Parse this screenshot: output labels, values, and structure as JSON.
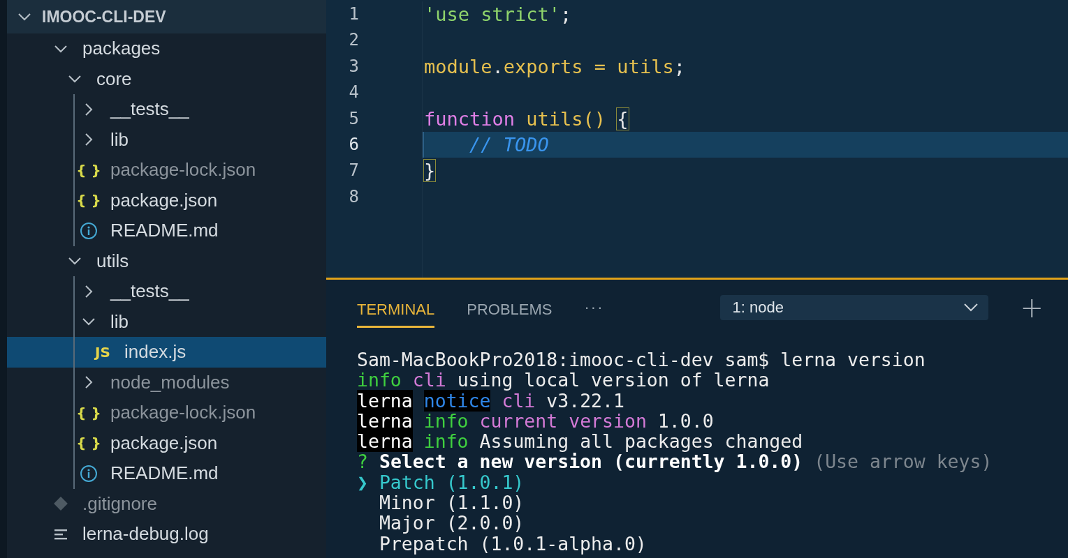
{
  "explorer": {
    "root": {
      "label": "IMOOC-CLI-DEV",
      "expanded": true
    },
    "items": [
      {
        "label": "packages",
        "kind": "folder",
        "expanded": true,
        "children": [
          {
            "label": "core",
            "kind": "folder",
            "expanded": true,
            "children": [
              {
                "label": "__tests__",
                "kind": "folder",
                "expanded": false
              },
              {
                "label": "lib",
                "kind": "folder",
                "expanded": false
              },
              {
                "icon": "{ }",
                "label": "package-lock.json",
                "kind": "json",
                "ignored": true
              },
              {
                "icon": "{ }",
                "label": "package.json",
                "kind": "json",
                "ignored": false
              },
              {
                "label": "README.md",
                "kind": "info",
                "ignored": false
              }
            ]
          },
          {
            "label": "utils",
            "kind": "folder",
            "expanded": true,
            "children": [
              {
                "label": "__tests__",
                "kind": "folder",
                "expanded": false
              },
              {
                "label": "lib",
                "kind": "folder",
                "expanded": true,
                "children": [
                  {
                    "icon": "JS",
                    "label": "index.js",
                    "kind": "js",
                    "ignored": false,
                    "selected": true
                  }
                ]
              },
              {
                "label": "node_modules",
                "kind": "folder",
                "expanded": false,
                "ignored": true
              },
              {
                "icon": "{ }",
                "label": "package-lock.json",
                "kind": "json",
                "ignored": true
              },
              {
                "icon": "{ }",
                "label": "package.json",
                "kind": "json",
                "ignored": false
              },
              {
                "label": "README.md",
                "kind": "info",
                "ignored": false
              }
            ]
          }
        ]
      },
      {
        "label": ".gitignore",
        "kind": "git",
        "ignored": true
      },
      {
        "label": "lerna-debug.log",
        "kind": "log",
        "ignored": false
      }
    ]
  },
  "editor": {
    "lines": [
      {
        "number": "1",
        "current": false,
        "tokens": [
          {
            "text": "'use strict'",
            "kind": "string"
          },
          {
            "text": ";",
            "kind": "punct"
          }
        ]
      },
      {
        "number": "2",
        "current": false
      },
      {
        "number": "3",
        "current": false,
        "tokens": [
          {
            "text": "module",
            "kind": "identifier"
          },
          {
            "text": ".",
            "kind": "punct"
          },
          {
            "text": "exports = utils",
            "kind": "identifier"
          },
          {
            "text": ";",
            "kind": "punct"
          }
        ]
      },
      {
        "number": "4",
        "current": false
      },
      {
        "number": "5",
        "current": false,
        "tokens": [
          {
            "text": "function",
            "kind": "keyword"
          },
          {
            "text": " utils() ",
            "kind": "identifier"
          },
          {
            "text": "{",
            "kind": "bracket"
          }
        ]
      },
      {
        "number": "6",
        "current": true,
        "tokens": [
          {
            "text": "    // TODO",
            "kind": "comment"
          }
        ]
      },
      {
        "number": "7",
        "current": false,
        "tokens": [
          {
            "text": "}",
            "kind": "bracket"
          }
        ]
      },
      {
        "number": "8",
        "current": false
      }
    ]
  },
  "panel": {
    "tabs": [
      {
        "label": "TERMINAL",
        "selected": true
      },
      {
        "label": "PROBLEMS",
        "selected": false
      }
    ],
    "more": "···",
    "terminal_select": "1: node",
    "add": "+",
    "terminal": [
      [
        {
          "text": "Sam-MacBookPro2018:imooc-cli-dev sam$ lerna version",
          "kind": "output"
        }
      ],
      [
        {
          "text": "info",
          "kind": "level"
        },
        {
          "text": " cli",
          "kind": "scope"
        },
        {
          "text": " using local version of lerna",
          "kind": "output"
        }
      ],
      [
        {
          "text": "lerna",
          "kind": "prefix"
        },
        {
          "text": " notice",
          "kind": "notice"
        },
        {
          "text": " cli",
          "kind": "scope"
        },
        {
          "text": " v3.22.1",
          "kind": "output"
        }
      ],
      [
        {
          "text": "lerna",
          "kind": "prefix"
        },
        {
          "text": " info",
          "kind": "level"
        },
        {
          "text": " current version",
          "kind": "scope"
        },
        {
          "text": " 1.0.0",
          "kind": "output"
        }
      ],
      [
        {
          "text": "lerna",
          "kind": "prefix"
        },
        {
          "text": " info",
          "kind": "level"
        },
        {
          "text": " Assuming all packages changed",
          "kind": "output"
        }
      ],
      [
        {
          "text": "?",
          "kind": "level"
        },
        {
          "text": " Select a new version (currently 1.0.0)",
          "kind": "question"
        },
        {
          "text": " (Use arrow keys)",
          "kind": "hint"
        }
      ],
      [
        {
          "text": "❯ Patch (1.0.1)",
          "kind": "choice"
        }
      ],
      [
        {
          "text": "  Minor (1.1.0)",
          "kind": "output"
        }
      ],
      [
        {
          "text": "  Major (2.0.0)",
          "kind": "output"
        }
      ],
      [
        {
          "text": "  Prepatch (1.0.1-alpha.0)",
          "kind": "output"
        }
      ]
    ]
  }
}
